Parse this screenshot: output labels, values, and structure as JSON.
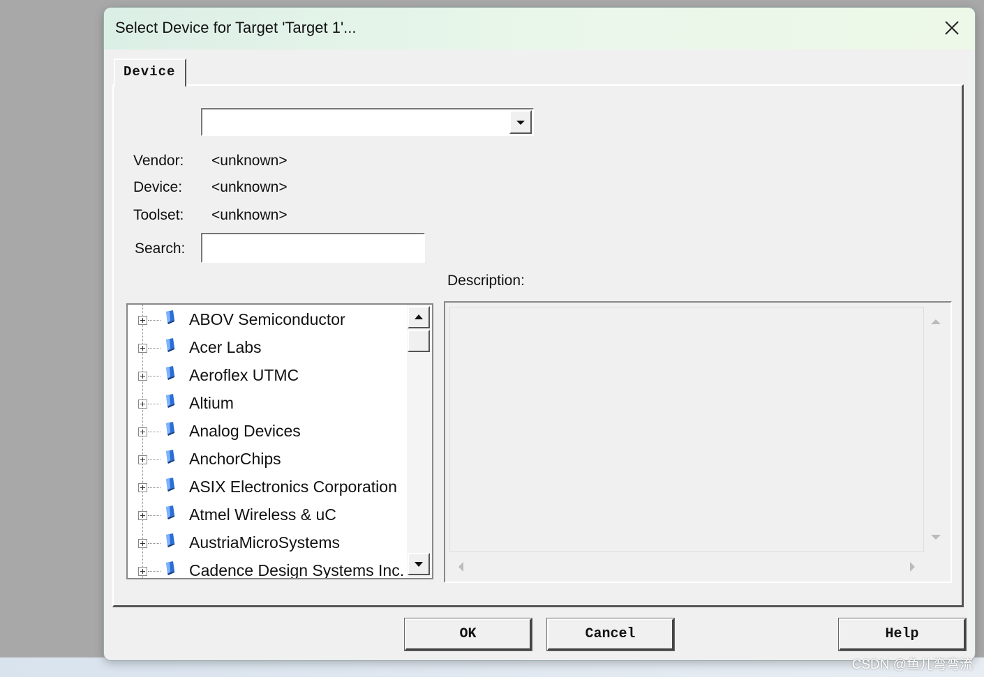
{
  "dialog": {
    "title": "Select Device for Target 'Target 1'...",
    "tab_label": "Device"
  },
  "device_info": {
    "vendor_label": "Vendor:",
    "vendor_value": "<unknown>",
    "device_label": "Device:",
    "device_value": "<unknown>",
    "toolset_label": "Toolset:",
    "toolset_value": "<unknown>",
    "search_label": "Search:",
    "search_value": ""
  },
  "combo": {
    "selected": ""
  },
  "description": {
    "label": "Description:",
    "text": ""
  },
  "vendor_tree": {
    "items": [
      {
        "label": "ABOV Semiconductor"
      },
      {
        "label": "Acer Labs"
      },
      {
        "label": "Aeroflex UTMC"
      },
      {
        "label": "Altium"
      },
      {
        "label": "Analog Devices"
      },
      {
        "label": "AnchorChips"
      },
      {
        "label": "ASIX Electronics Corporation"
      },
      {
        "label": "Atmel Wireless & uC"
      },
      {
        "label": "AustriaMicroSystems"
      },
      {
        "label": "Cadence Design Systems Inc."
      }
    ]
  },
  "buttons": {
    "ok": "OK",
    "cancel": "Cancel",
    "help": "Help"
  },
  "watermark": "CSDN @鱼儿弯弯流",
  "icons": {
    "close": "close-icon",
    "dropdown": "chevron-down-icon",
    "tree_expand": "plus-box-icon",
    "vendor": "chip-icon"
  },
  "colors": {
    "dialog_bg": "#f0f0f0",
    "titlebar": "#e9f7ea",
    "icon_blue": "#2a6fd6"
  }
}
